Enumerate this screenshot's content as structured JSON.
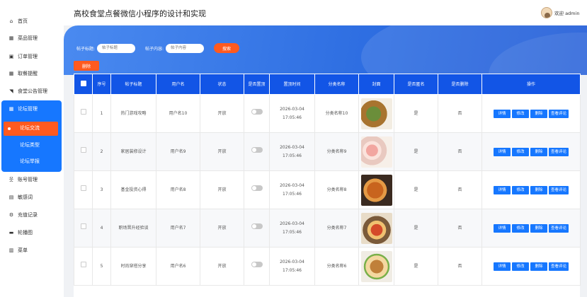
{
  "sidebar": {
    "items": [
      {
        "icon": "home-icon",
        "glyph": "⌂",
        "label": "首页"
      },
      {
        "icon": "grid-icon",
        "glyph": "▦",
        "label": "菜品管理"
      },
      {
        "icon": "cart-icon",
        "glyph": "▣",
        "label": "订单管理"
      },
      {
        "icon": "grid-icon",
        "glyph": "▦",
        "label": "取餐提醒"
      },
      {
        "icon": "megaphone-icon",
        "glyph": "◥",
        "label": "食堂公告管理"
      },
      {
        "icon": "grid-icon",
        "glyph": "▦",
        "label": "论坛管理"
      },
      {
        "icon": "user-icon",
        "glyph": "웃",
        "label": "账号管理"
      },
      {
        "icon": "book-icon",
        "glyph": "▤",
        "label": "敏感词"
      },
      {
        "icon": "gear-icon",
        "glyph": "⚙",
        "label": "充值记录"
      },
      {
        "icon": "image-icon",
        "glyph": "▬",
        "label": "轮播图"
      },
      {
        "icon": "menu-icon",
        "glyph": "▥",
        "label": "菜单"
      }
    ],
    "forum_subitems": [
      "论坛交流",
      "论坛类型",
      "论坛举报"
    ]
  },
  "header": {
    "title": "高校食堂点餐微信小程序的设计和实现",
    "welcome": "欢迎 admin"
  },
  "search": {
    "title_label": "帖子标题:",
    "title_placeholder": "帖子标题",
    "content_label": "帖子内容:",
    "content_placeholder": "帖子内容",
    "search_button": "搜索"
  },
  "toolbar": {
    "delete_button": "删除"
  },
  "table": {
    "headers": [
      "",
      "序号",
      "帖子标题",
      "用户名",
      "状态",
      "是否置顶",
      "置顶时间",
      "分类名称",
      "封面",
      "是否匿名",
      "是否删除",
      "操作"
    ],
    "actions": [
      "详情",
      "修改",
      "删除",
      "查看评论"
    ],
    "rows": [
      {
        "index": "1",
        "title": "热门游戏攻略",
        "user": "用户名10",
        "status": "开放",
        "time": "2026-03-04 17:05:46",
        "category": "分类名称10",
        "anon": "是",
        "deleted": "否"
      },
      {
        "index": "2",
        "title": "家居装修设计",
        "user": "用户名9",
        "status": "开放",
        "time": "2026-03-04 17:05:46",
        "category": "分类名称9",
        "anon": "是",
        "deleted": "否"
      },
      {
        "index": "3",
        "title": "基金投资心得",
        "user": "用户名8",
        "status": "开放",
        "time": "2026-03-04 17:05:46",
        "category": "分类名称8",
        "anon": "是",
        "deleted": "否"
      },
      {
        "index": "4",
        "title": "职场晋升经验谈",
        "user": "用户名7",
        "status": "开放",
        "time": "2026-03-04 17:05:46",
        "category": "分类名称7",
        "anon": "是",
        "deleted": "否"
      },
      {
        "index": "5",
        "title": "时尚穿搭分享",
        "user": "用户名6",
        "status": "开放",
        "time": "2026-03-04 17:05:46",
        "category": "分类名称6",
        "anon": "是",
        "deleted": "否"
      }
    ]
  },
  "colors": {
    "primary": "#1677ff",
    "header_blue": "#1255e6",
    "accent_orange": "#ff5a1f"
  }
}
